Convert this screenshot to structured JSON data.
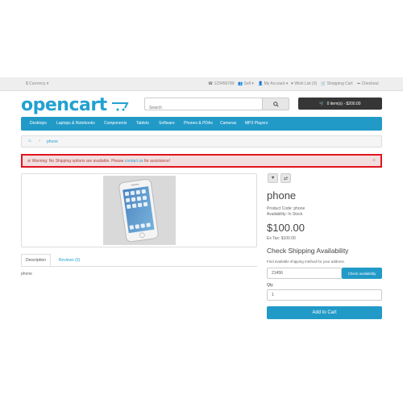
{
  "topbar": {
    "currency": "$ Currency ▾",
    "phone": "123456789",
    "sell": "Sell ▾",
    "account": "My Account ▾",
    "wishlist": "Wish List (0)",
    "cart": "Shopping Cart",
    "checkout": "Checkout"
  },
  "header": {
    "logo": "opencart",
    "search_placeholder": "Search",
    "cart_button": "0 item(s) - $200.00"
  },
  "nav": {
    "items": [
      "Desktops",
      "Laptops & Notebooks",
      "Components",
      "Tablets",
      "Software",
      "Phones & PDAs",
      "Cameras",
      "MP3 Players"
    ]
  },
  "breadcrumb": {
    "current": "phone"
  },
  "alert": {
    "prefix": "Warning: No Shipping options are available. Please ",
    "link": "contact us",
    "suffix": " for assistance!",
    "close": "×"
  },
  "tabs": {
    "description": "Description",
    "reviews": "Reviews (0)"
  },
  "description_text": "phone",
  "product": {
    "title": "phone",
    "code": "Product Code: phone",
    "availability": "Availability: In Stock",
    "price": "$100.00",
    "ex_tax": "Ex Tax: $100.00"
  },
  "shipping": {
    "heading": "Check Shipping Availability",
    "subtext": "Find available shipping method for your address.",
    "zip_value": "21456",
    "check_button": "Check availability"
  },
  "qty": {
    "label": "Qty",
    "value": "1"
  },
  "add_to_cart": "Add to Cart",
  "colors": {
    "brand": "#23a1d1",
    "nav": "#229ac8",
    "alert_border": "#e0141e"
  }
}
